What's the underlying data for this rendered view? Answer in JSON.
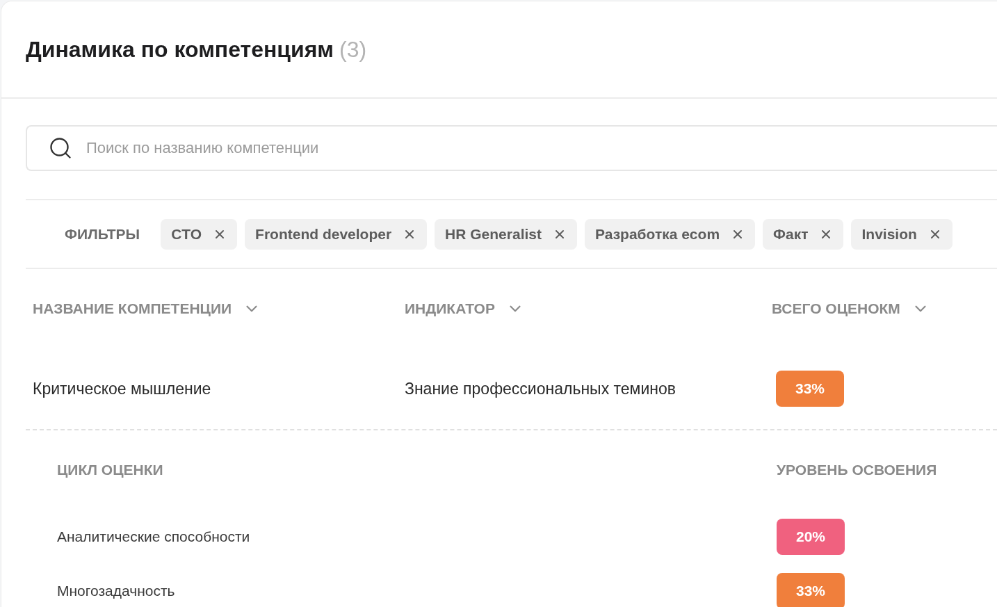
{
  "title": {
    "text": "Динамика по компетенциям",
    "count": "(3)"
  },
  "search": {
    "placeholder": "Поиск по названию компетенции"
  },
  "filters": {
    "label": "ФИЛЬТРЫ",
    "chips": [
      "CTO",
      "Frontend developer",
      "HR Generalist",
      "Разработка ecom",
      "Факт",
      "Invision"
    ]
  },
  "table": {
    "columns": [
      "НАЗВАНИЕ КОМПЕТЕНЦИИ",
      "ИНДИКАТОР",
      "ВСЕГО ОЦЕНОКМ"
    ],
    "rows": [
      {
        "name": "Критическое мышление",
        "indicator": "Знание профессиональных теминов",
        "total": "33%",
        "color": "#f07f3c",
        "expanded": true,
        "details": {
          "columns": [
            "ЦИКЛ ОЦЕНКИ",
            "УРОВЕНЬ ОСВОЕНИЯ"
          ],
          "rows": [
            {
              "cycle": "Аналитические способности",
              "level": "20%",
              "color": "#f0617f"
            },
            {
              "cycle": "Многозадачность",
              "level": "33%",
              "color": "#f07f3c"
            }
          ]
        }
      }
    ]
  }
}
